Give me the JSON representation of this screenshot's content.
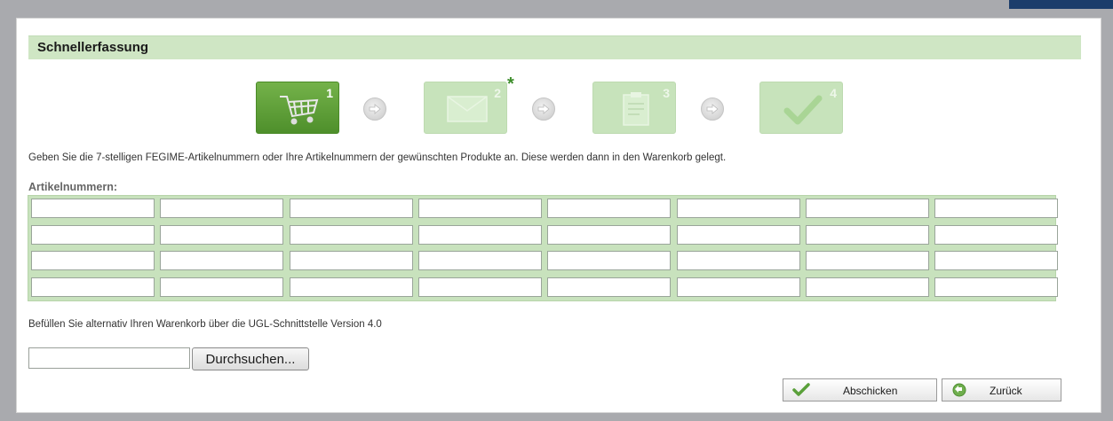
{
  "panel": {
    "title": "Schnellerfassung"
  },
  "steps": [
    {
      "number": "1",
      "icon": "shopping-cart-icon",
      "active": true
    },
    {
      "number": "2",
      "icon": "envelope-icon",
      "active": false,
      "marker": "*"
    },
    {
      "number": "3",
      "icon": "clipboard-icon",
      "active": false
    },
    {
      "number": "4",
      "icon": "checkmark-icon",
      "active": false
    }
  ],
  "intro_text": "Geben Sie die 7-stelligen FEGIME-Artikelnummern oder Ihre Artikelnummern der gewünschten Produkte an. Diese werden dann in den Warenkorb gelegt.",
  "article_numbers": {
    "label": "Artikelnummern:",
    "rows": 4,
    "columns": 8,
    "values": [
      [
        "",
        "",
        "",
        "",
        "",
        "",
        "",
        ""
      ],
      [
        "",
        "",
        "",
        "",
        "",
        "",
        "",
        ""
      ],
      [
        "",
        "",
        "",
        "",
        "",
        "",
        "",
        ""
      ],
      [
        "",
        "",
        "",
        "",
        "",
        "",
        "",
        ""
      ]
    ]
  },
  "ugl": {
    "text": "Befüllen Sie alternativ Ihren Warenkorb über die UGL-Schnittstelle Version 4.0",
    "file_value": "",
    "browse_label": "Durchsuchen..."
  },
  "actions": {
    "submit_label": "Abschicken",
    "back_label": "Zurück"
  },
  "colors": {
    "accent_green": "#5a9a34",
    "header_green": "#cfe6c4",
    "grid_green": "#c8e2bd"
  }
}
